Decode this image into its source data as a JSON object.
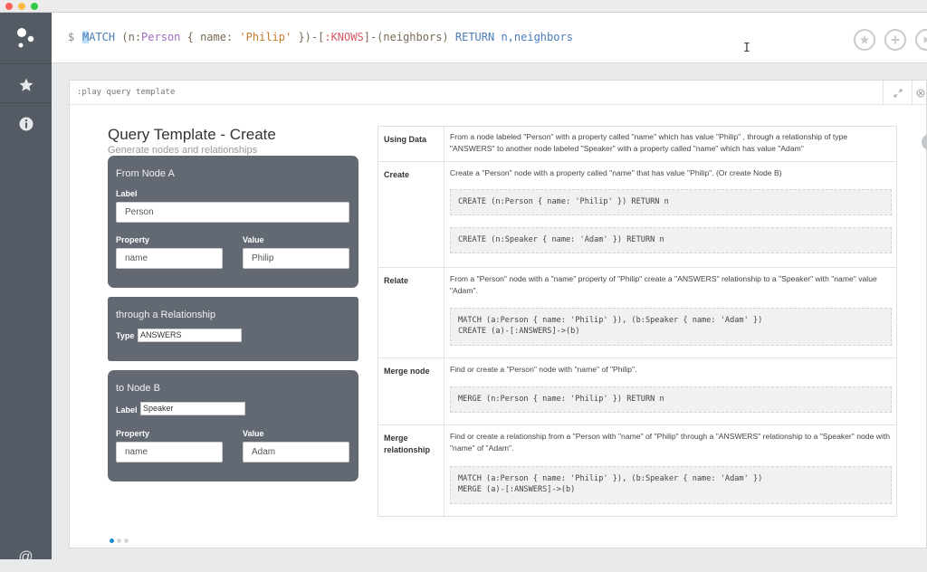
{
  "window": {
    "traffic_lights": {
      "close": "#fc605c",
      "minimize": "#fdbc40",
      "zoom": "#34c84a"
    }
  },
  "sidebar": {
    "items": [
      {
        "icon": "neo4j-logo-icon"
      },
      {
        "icon": "star-icon"
      },
      {
        "icon": "info-icon"
      },
      {
        "icon": "at-icon"
      }
    ]
  },
  "editor": {
    "prompt": "$",
    "query_parts": {
      "match": "MATCH",
      "open": " (n:",
      "person": "Person",
      "brace_open": " { name: ",
      "philip": "'Philip'",
      "brace_close": " })-[",
      "knows": ":KNOWS",
      "tail": "]-(neighbors) ",
      "return": "RETURN",
      "ret_vals": " n,neighbors"
    },
    "buttons": [
      "favorite-icon",
      "plus-icon",
      "play-icon"
    ]
  },
  "frame": {
    "command": ":play query template"
  },
  "template": {
    "title": "Query Template - Create",
    "subtitle": "Generate nodes and relationships",
    "node_a": {
      "title": "From Node A",
      "label_caption": "Label",
      "label_placeholder": "Person",
      "property_caption": "Property",
      "property_placeholder": "name",
      "value_caption": "Value",
      "value_placeholder": "Philip"
    },
    "relationship": {
      "title": "through a Relationship",
      "type_caption": "Type",
      "type_value": "ANSWERS"
    },
    "node_b": {
      "title": "to Node B",
      "label_caption": "Label",
      "label_value": "Speaker",
      "property_caption": "Property",
      "property_placeholder": "name",
      "value_caption": "Value",
      "value_placeholder": "Adam"
    }
  },
  "table": {
    "using_data": {
      "head": "Using Data",
      "text": "From a node labeled \"Person\" with a property called \"name\" which has value \"Philip\" , through a relationship of type \"ANSWERS\" to another node labeled \"Speaker\" with a property called \"name\" which has value \"Adam\""
    },
    "create": {
      "head": "Create",
      "text": "Create a \"Person\" node with a property called \"name\" that has value \"Philip\". (Or create Node B)",
      "code1": "CREATE (n:Person { name: 'Philip' }) RETURN n",
      "code2": "CREATE (n:Speaker { name: 'Adam' }) RETURN n"
    },
    "relate": {
      "head": "Relate",
      "text": "From a \"Person\" node with a \"name\" property of \"Philip\" create a \"ANSWERS\" relationship to a \"Speaker\" with \"name\" value \"Adam\".",
      "code": "MATCH (a:Person { name: 'Philip' }), (b:Speaker { name: 'Adam' })\nCREATE (a)-[:ANSWERS]->(b)"
    },
    "merge_node": {
      "head": "Merge node",
      "text": "Find or create a \"Person\" node with \"name\" of \"Philip\".",
      "code": "MERGE (n:Person { name: 'Philip' }) RETURN n"
    },
    "merge_rel": {
      "head": "Merge relationship",
      "text": "Find or create a relationship from a \"Person with \"name\" of \"Philip\" through a \"ANSWERS\" relationship to a \"Speaker\" node with \"name\" of \"Adam\".",
      "code": "MATCH (a:Person { name: 'Philip' }), (b:Speaker { name: 'Adam' })\nMERGE (a)-[:ANSWERS]->(b)"
    }
  },
  "pager": {
    "pages": 3,
    "active_page": 1,
    "active_color": "#1b8bd1",
    "inactive_color": "#d3d6da"
  }
}
